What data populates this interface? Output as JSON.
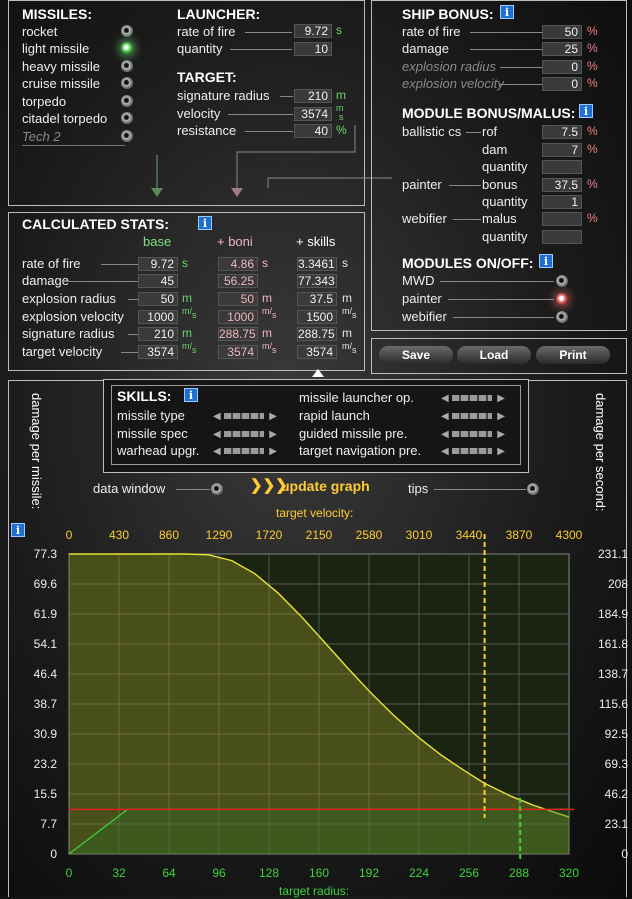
{
  "missiles": {
    "title": "MISSILES:",
    "items": [
      {
        "label": "rocket",
        "selected": false,
        "disabled": false
      },
      {
        "label": "light missile",
        "selected": true,
        "disabled": false
      },
      {
        "label": "heavy missile",
        "selected": false,
        "disabled": false
      },
      {
        "label": "cruise missile",
        "selected": false,
        "disabled": false
      },
      {
        "label": "torpedo",
        "selected": false,
        "disabled": false
      },
      {
        "label": "citadel torpedo",
        "selected": false,
        "disabled": false
      },
      {
        "label": "Tech 2",
        "selected": false,
        "disabled": true
      }
    ]
  },
  "launcher": {
    "title": "LAUNCHER:",
    "rate_label": "rate of fire",
    "rate_value": "9.72",
    "rate_unit": "s",
    "qty_label": "quantity",
    "qty_value": "10"
  },
  "target": {
    "title": "TARGET:",
    "sig_label": "signature radius",
    "sig_value": "210",
    "sig_unit": "m",
    "vel_label": "velocity",
    "vel_value": "3574",
    "vel_unit_top": "m",
    "vel_unit_bot": "s",
    "res_label": "resistance",
    "res_value": "40",
    "res_unit": "%"
  },
  "ship_bonus": {
    "title": "SHIP BONUS:",
    "rows": [
      {
        "label": "rate of fire",
        "value": "50",
        "unit": "%",
        "disabled": false
      },
      {
        "label": "damage",
        "value": "25",
        "unit": "%",
        "disabled": false
      },
      {
        "label": "explosion radius",
        "value": "0",
        "unit": "%",
        "disabled": true
      },
      {
        "label": "explosion velocity",
        "value": "0",
        "unit": "%",
        "disabled": true
      }
    ]
  },
  "module_bonus": {
    "title": "MODULE BONUS/MALUS:",
    "ballistic_label": "ballistic cs",
    "painter_label": "painter",
    "webifier_label": "webifier",
    "rows": [
      {
        "label": "rof",
        "value": "7.5",
        "unit": "%"
      },
      {
        "label": "dam",
        "value": "7",
        "unit": "%"
      },
      {
        "label": "quantity",
        "value": "",
        "unit": ""
      },
      {
        "label": "bonus",
        "value": "37.5",
        "unit": "%"
      },
      {
        "label": "quantity",
        "value": "1",
        "unit": ""
      },
      {
        "label": "malus",
        "value": "",
        "unit": "%"
      },
      {
        "label": "quantity",
        "value": "",
        "unit": ""
      }
    ]
  },
  "modules_onoff": {
    "title": "MODULES ON/OFF:",
    "items": [
      {
        "label": "MWD",
        "state": "off"
      },
      {
        "label": "painter",
        "state": "on"
      },
      {
        "label": "webifier",
        "state": "off"
      }
    ]
  },
  "calc": {
    "title": "CALCULATED STATS:",
    "col_base": "base",
    "col_boni": "+ boni",
    "col_skills": "+ skills",
    "rows": [
      {
        "label": "rate of fire",
        "base": "9.72",
        "boni": "4.86",
        "skills": "3.3461",
        "unit_a": "s",
        "unit_b": "s",
        "unit_c": "s"
      },
      {
        "label": "damage",
        "base": "45",
        "boni": "56.25",
        "skills": "77.343",
        "unit_a": "",
        "unit_b": "",
        "unit_c": ""
      },
      {
        "label": "explosion radius",
        "base": "50",
        "boni": "50",
        "skills": "37.5",
        "unit_a": "m",
        "unit_b": "m",
        "unit_c": "m"
      },
      {
        "label": "explosion velocity",
        "base": "1000",
        "boni": "1000",
        "skills": "1500",
        "unit_a": "m/s",
        "unit_b": "m/s",
        "unit_c": "m/s"
      },
      {
        "label": "signature radius",
        "base": "210",
        "boni": "288.75",
        "skills": "288.75",
        "unit_a": "m",
        "unit_b": "m",
        "unit_c": "m"
      },
      {
        "label": "target velocity",
        "base": "3574",
        "boni": "3574",
        "skills": "3574",
        "unit_a": "m/s",
        "unit_b": "m/s",
        "unit_c": "m/s"
      }
    ]
  },
  "buttons": {
    "save": "Save",
    "load": "Load",
    "print": "Print"
  },
  "skills": {
    "title": "SKILLS:",
    "left": [
      "missile type",
      "missile spec",
      "warhead upgr."
    ],
    "right": [
      "missile launcher op.",
      "rapid launch",
      "guided missile pre.",
      "target navigation pre."
    ]
  },
  "controls": {
    "data_window": "data window",
    "update_graph": "update graph",
    "update_arrows": "❯❯❯",
    "tips": "tips"
  },
  "side_labels": {
    "left": "damage per missile:",
    "right": "damage per second:"
  },
  "info_icon": "i",
  "colors": {
    "accent_yellow": "#ffcc33",
    "curve_yellow": "#e8e23a",
    "radius_green": "#3fd23f",
    "line_red": "#e02020",
    "info_blue": "#1f6fcf"
  },
  "chart_data": {
    "type": "line",
    "x_top_label": "target velocity:",
    "x_bottom_label": "target radius:",
    "x_top_ticks": [
      "0",
      "430",
      "860",
      "1290",
      "1720",
      "2150",
      "2580",
      "3010",
      "3440",
      "3870",
      "4300"
    ],
    "x_bottom_ticks": [
      "0",
      "32",
      "64",
      "96",
      "128",
      "160",
      "192",
      "224",
      "256",
      "288",
      "320"
    ],
    "y_left_ticks": [
      "77.3",
      "69.6",
      "61.9",
      "54.1",
      "46.4",
      "38.7",
      "30.9",
      "23.2",
      "15.5",
      "7.7",
      "0"
    ],
    "y_right_ticks": [
      "231.1",
      "208",
      "184.9",
      "161.8",
      "138.7",
      "115.6",
      "92.5",
      "69.3",
      "46.2",
      "23.1",
      "0"
    ],
    "xlim_velocity": [
      0,
      4300
    ],
    "xlim_radius": [
      0,
      320
    ],
    "ylim_damage": [
      0,
      77.3
    ],
    "series": [
      {
        "x_axis": "target velocity",
        "x": [
          0,
          1000,
          1200,
          1400,
          1600,
          1800,
          2000,
          2200,
          2400,
          2600,
          2800,
          3000,
          3200,
          3400,
          3574,
          3800,
          4000,
          4300
        ],
        "y": [
          77.3,
          77.3,
          77.1,
          75.6,
          72.2,
          67.2,
          61.1,
          54.5,
          47.8,
          41.4,
          35.5,
          30.2,
          25.5,
          21.5,
          18.2,
          14.9,
          12.5,
          9.5
        ]
      },
      {
        "x_axis": "target radius",
        "x": [
          0,
          37.5,
          320
        ],
        "y": [
          0,
          11.5,
          11.5
        ]
      }
    ],
    "threshold_damage": 11.5,
    "marker_velocity": 3574,
    "marker_radius": 288.75,
    "grid": true
  }
}
